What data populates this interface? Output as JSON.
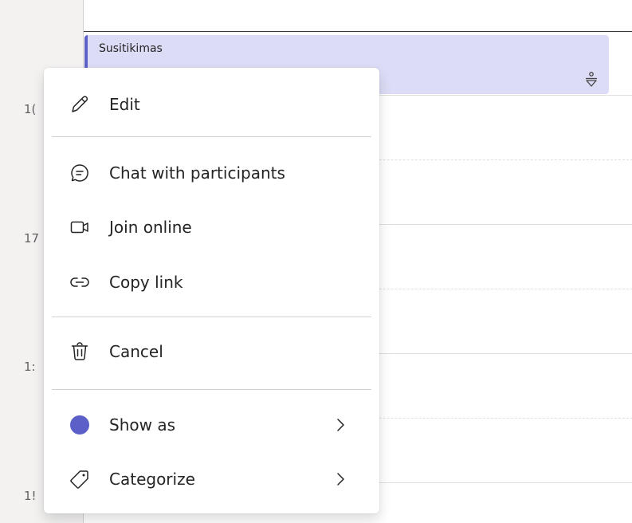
{
  "calendar": {
    "time_labels": [
      "1(",
      "17",
      "1:",
      "1!"
    ],
    "event": {
      "title": "Susitikimas",
      "accent_color": "#5b5fc7",
      "background_color": "#dcdcf6",
      "icon": "person-location-icon"
    }
  },
  "context_menu": {
    "items": [
      {
        "id": "edit",
        "label": "Edit",
        "icon": "pencil-icon"
      },
      {
        "id": "chat",
        "label": "Chat with participants",
        "icon": "chat-icon"
      },
      {
        "id": "join",
        "label": "Join online",
        "icon": "video-camera-icon"
      },
      {
        "id": "copy",
        "label": "Copy link",
        "icon": "link-icon"
      },
      {
        "id": "cancel",
        "label": "Cancel",
        "icon": "trash-icon"
      },
      {
        "id": "show_as",
        "label": "Show as",
        "icon": "status-dot-icon",
        "has_submenu": true,
        "status_color": "#5b5fc7"
      },
      {
        "id": "categorize",
        "label": "Categorize",
        "icon": "tag-icon",
        "has_submenu": true
      }
    ]
  }
}
